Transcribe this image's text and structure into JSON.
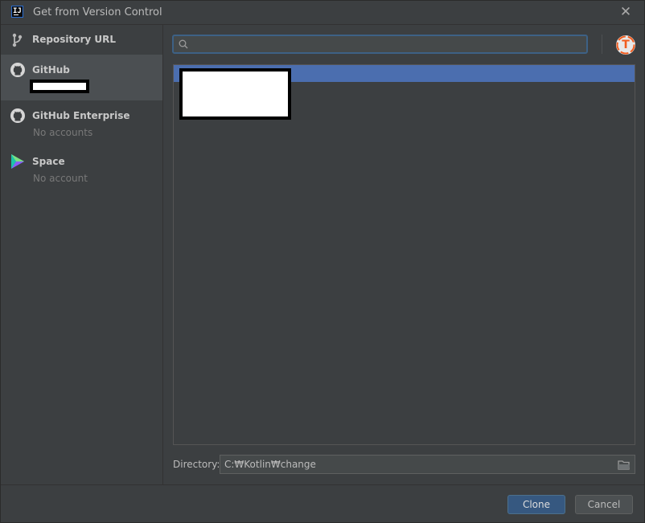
{
  "window": {
    "title": "Get from Version Control"
  },
  "sidebar": {
    "items": [
      {
        "label": "Repository URL",
        "sublabel": "",
        "icon": "branch-icon",
        "selected": false
      },
      {
        "label": "GitHub",
        "sublabel": "",
        "icon": "github-icon",
        "selected": true
      },
      {
        "label": "GitHub Enterprise",
        "sublabel": "No accounts",
        "icon": "github-icon",
        "selected": false
      },
      {
        "label": "Space",
        "sublabel": "No account",
        "icon": "space-icon",
        "selected": false
      }
    ]
  },
  "search": {
    "value": "",
    "placeholder": ""
  },
  "avatar": {
    "letter": "T"
  },
  "directory": {
    "label": "Directory:",
    "value": "C:₩Kotlin₩change"
  },
  "buttons": {
    "clone": "Clone",
    "cancel": "Cancel"
  },
  "colors": {
    "accent": "#4b6eaf",
    "primary_button": "#365880",
    "background": "#3c3f41"
  }
}
